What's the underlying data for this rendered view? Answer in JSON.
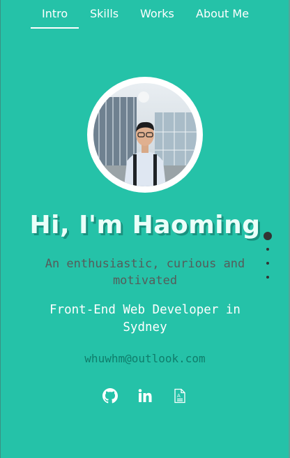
{
  "nav": {
    "tabs": [
      {
        "label": "Intro",
        "active": true
      },
      {
        "label": "Skills"
      },
      {
        "label": "Works"
      },
      {
        "label": "About Me"
      }
    ]
  },
  "hero": {
    "title": "Hi, I'm Haoming",
    "subtitle": "An enthusiastic, curious and motivated",
    "role": "Front-End Web Developer in Sydney",
    "email": "whuwhm@outlook.com"
  },
  "socials": [
    "github-icon",
    "linkedin-icon",
    "resume-icon"
  ],
  "pager": {
    "count": 4,
    "active_index": 0
  },
  "colors": {
    "background": "#25c2a8",
    "text": "#ffffff",
    "email": "#0f7d6b",
    "subtitle": "#555c5a"
  }
}
